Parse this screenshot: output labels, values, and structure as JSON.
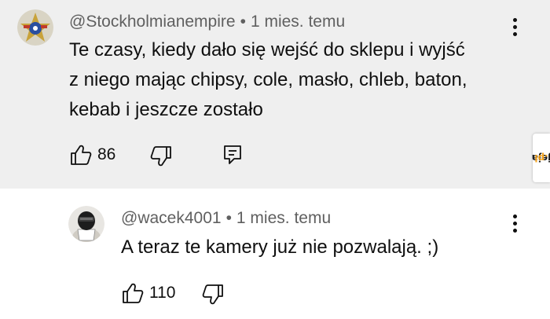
{
  "comments": [
    {
      "author": "@Stockholmianempire",
      "time": "1 mies. temu",
      "text_lines": [
        "Te czasy, kiedy dało się wejść do sklepu i wyjść",
        "z niego mając chipsy, cole, masło, chleb, baton,",
        "kebab i jeszcze zostało"
      ],
      "likes": "86"
    },
    {
      "author": "@wacek4001",
      "time": "1 mies. temu",
      "text_lines": [
        "A teraz te kamery już nie pozwalają. ;)"
      ],
      "likes": "110"
    }
  ],
  "separator": "•",
  "watermark": {
    "text": "jeja.pl",
    "part1": "jeja",
    "part2": ".pl",
    "color_main": "#1a1a1a",
    "color_accent": "#f5a623"
  },
  "colors": {
    "top_background": "#efefef",
    "meta_text": "#606060",
    "body_text": "#0f0f0f"
  }
}
